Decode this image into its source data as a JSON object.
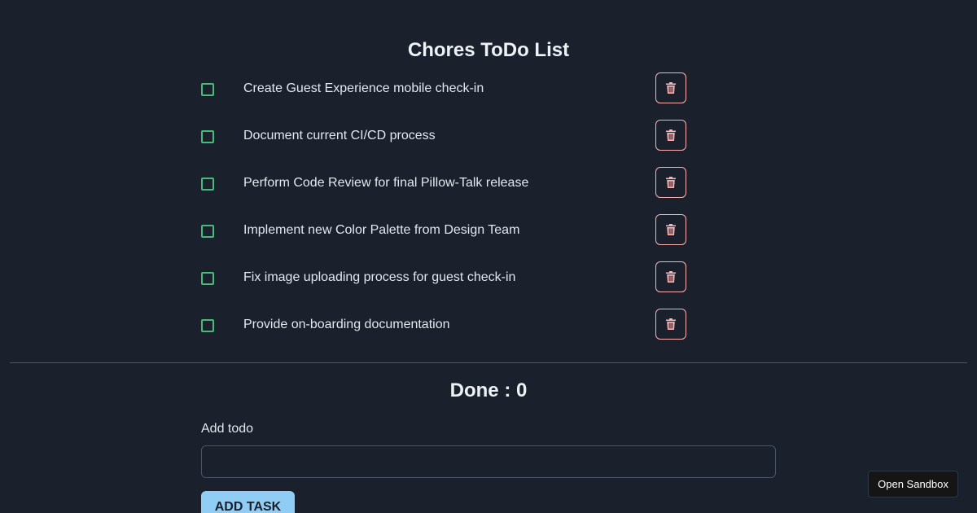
{
  "title": "Chores ToDo List",
  "todos": [
    {
      "text": "Create Guest Experience mobile check-in",
      "done": false
    },
    {
      "text": "Document current CI/CD process",
      "done": false
    },
    {
      "text": "Perform Code Review for final Pillow-Talk release",
      "done": false
    },
    {
      "text": "Implement new Color Palette from Design Team",
      "done": false
    },
    {
      "text": "Fix image uploading process for guest check-in",
      "done": false
    },
    {
      "text": "Provide on-boarding documentation",
      "done": false
    }
  ],
  "done_heading": "Done : 0",
  "add_form": {
    "label": "Add todo",
    "value": "",
    "button_label": "ADD TASK"
  },
  "sandbox_button": "Open Sandbox",
  "icons": {
    "checkbox": "checkbox-icon",
    "delete": "trash-icon"
  },
  "colors": {
    "background": "#1a202c",
    "checkbox_border": "#48bb78",
    "delete_accent": "#feb2b2",
    "add_button": "#90cdf4"
  }
}
